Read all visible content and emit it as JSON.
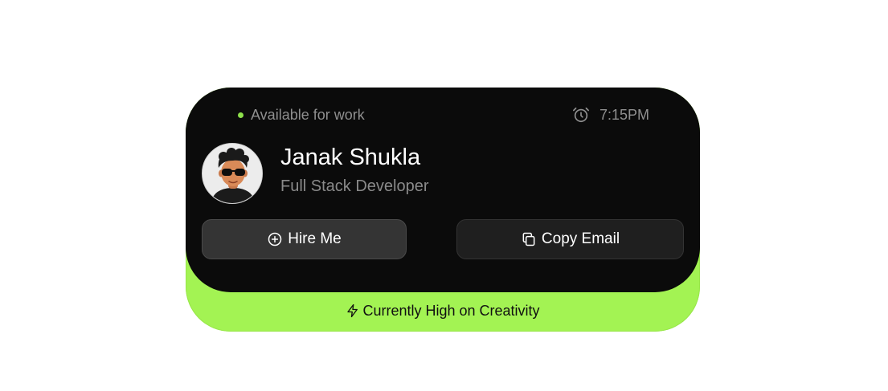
{
  "status": {
    "label": "Available for work",
    "dot_color": "#8ee04b",
    "time": "7:15PM",
    "time_icon": "alarm-clock-icon"
  },
  "profile": {
    "name": "Janak Shukla",
    "role": "Full Stack Developer",
    "avatar_icon": "avatar-3d-character"
  },
  "actions": {
    "hire_label": "Hire Me",
    "hire_icon": "plus-circle-icon",
    "copy_label": "Copy Email",
    "copy_icon": "copy-icon"
  },
  "footer": {
    "label": "Currently High on Creativity",
    "icon": "lightning-bolt-icon",
    "accent_color": "#a3f353"
  },
  "colors": {
    "card_bg": "#0b0b0b",
    "accent": "#a3f353"
  }
}
